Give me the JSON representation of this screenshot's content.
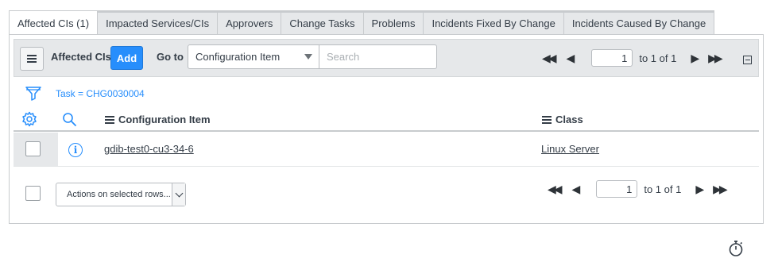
{
  "tabs": [
    {
      "label": "Affected CIs (1)",
      "active": true
    },
    {
      "label": "Impacted Services/CIs",
      "active": false
    },
    {
      "label": "Approvers",
      "active": false
    },
    {
      "label": "Change Tasks",
      "active": false
    },
    {
      "label": "Problems",
      "active": false
    },
    {
      "label": "Incidents Fixed By Change",
      "active": false
    },
    {
      "label": "Incidents Caused By Change",
      "active": false
    }
  ],
  "toolbar": {
    "list_title": "Affected CIs",
    "add_label": "Add",
    "goto_label": "Go to",
    "goto_field": "Configuration Item",
    "search_placeholder": "Search"
  },
  "pager": {
    "page": "1",
    "range_text": "to 1 of 1"
  },
  "filter": {
    "breadcrumb": "Task = CHG0030004"
  },
  "columns": [
    "Configuration Item",
    "Class"
  ],
  "rows": [
    {
      "configuration_item": "gdib-test0-cu3-34-6",
      "class": "Linux Server"
    }
  ],
  "footer": {
    "actions_label": "Actions on selected rows...",
    "page": "1",
    "range_text": "to 1 of 1"
  },
  "colors": {
    "accent": "#278efc",
    "toolbar_bg": "#e6e8ea",
    "border": "#c8cbce"
  },
  "icons": [
    "hamburger-icon",
    "caret-down-icon",
    "first-page-icon",
    "prev-page-icon",
    "next-page-icon",
    "last-page-icon",
    "collapse-icon",
    "filter-icon",
    "gear-icon",
    "search-icon",
    "info-icon",
    "chevron-down-icon",
    "timer-icon"
  ]
}
